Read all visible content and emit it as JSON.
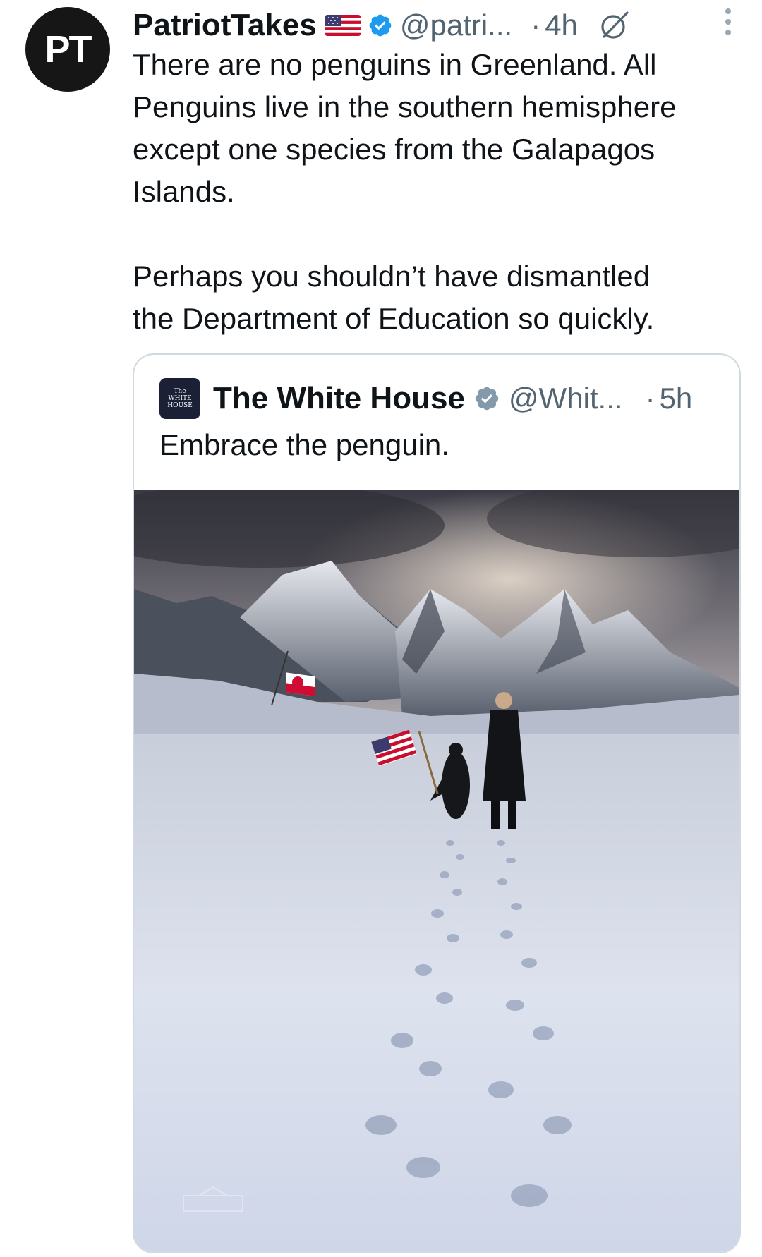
{
  "tweet": {
    "author_initials": "PT",
    "author_name": "PatriotTakes",
    "handle": "@patri...",
    "separator": "·",
    "time": "4h",
    "text": "There are no penguins in Greenland. All\nPenguins live in the southern hemisphere\nexcept one species from the Galapagos\nIslands.\n\nPerhaps you shouldn’t have dismantled\nthe Department of Education so quickly.",
    "icons": {
      "flag": "us-flag-icon",
      "verified": "verified-badge-icon",
      "grok": "grok-icon",
      "more": "more-options-icon"
    }
  },
  "quoted_tweet": {
    "author_name": "The White House",
    "avatar_lines": [
      "The",
      "WHITE",
      "HOUSE"
    ],
    "handle": "@Whit...",
    "separator": "·",
    "time": "5h",
    "text": "Embrace the penguin.",
    "image": {
      "description_icon": "photo-penguin-greenland",
      "has_greenland_flag": true,
      "has_us_flag": true
    }
  },
  "colors": {
    "text_primary": "#0f1419",
    "text_secondary": "#536471",
    "verified_blue": "#1d9bf0",
    "verified_gray": "#829aab",
    "border": "#cfd9de"
  }
}
